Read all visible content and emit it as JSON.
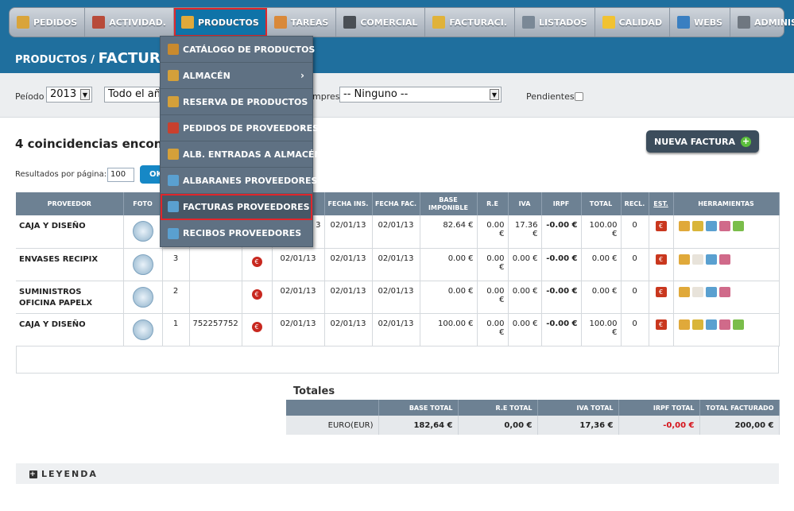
{
  "nav": {
    "items": [
      {
        "label": "PEDIDOS",
        "icon": "clipboard-icon",
        "color": "#d9a43a"
      },
      {
        "label": "ACTIVIDAD.",
        "icon": "puzzle-icon",
        "color": "#b84b3a"
      },
      {
        "label": "PRODUCTOS",
        "icon": "box-icon",
        "color": "#e0a93a"
      },
      {
        "label": "TAREAS",
        "icon": "folder-icon",
        "color": "#d9893a"
      },
      {
        "label": "COMERCIAL",
        "icon": "car-icon",
        "color": "#4a4f55"
      },
      {
        "label": "FACTURACI.",
        "icon": "bar-chart-icon",
        "color": "#e0b23a"
      },
      {
        "label": "LISTADOS",
        "icon": "printer-icon",
        "color": "#7a8896"
      },
      {
        "label": "CALIDAD",
        "icon": "star-icon",
        "color": "#f1c232"
      },
      {
        "label": "WEBS",
        "icon": "globe-icon",
        "color": "#3a7fc1"
      },
      {
        "label": "ADMINISTR.",
        "icon": "gear-icon",
        "color": "#6f7780"
      }
    ]
  },
  "header": {
    "section": "PRODUCTOS",
    "separator": "/",
    "title": "FACTURAS"
  },
  "filters": {
    "period_label": "Peíodo",
    "year_value": "2013",
    "range_value": "Todo el añ",
    "company_label": "mpresa",
    "company_value": "-- Ninguno --",
    "pending_label": "Pendientes"
  },
  "results": {
    "matches_text": "4 coincidencias encontra",
    "per_page_label": "Resultados por página:",
    "per_page_value": "100",
    "ok_label": "OK",
    "new_invoice_label": "NUEVA FACTURA",
    "plus_symbol": "+"
  },
  "menu": {
    "items": [
      {
        "label": "CATÁLOGO DE PRODUCTOS",
        "icon": "catalog-icon",
        "color": "#c98a2e",
        "submenu": ""
      },
      {
        "label": "ALMACÉN",
        "icon": "warehouse-icon",
        "color": "#d4a03a",
        "submenu": "›"
      },
      {
        "label": "RESERVA DE PRODUCTOS",
        "icon": "lock-box-icon",
        "color": "#d4a03a",
        "submenu": ""
      },
      {
        "label": "PEDIDOS DE PROVEEDORES",
        "icon": "order-box-icon",
        "color": "#c9402e",
        "submenu": "›"
      },
      {
        "label": "ALB. ENTRADAS A ALMACÉN",
        "icon": "delivery-icon",
        "color": "#d4a03a",
        "submenu": ""
      },
      {
        "label": "ALBARANES PROVEEDORES",
        "icon": "supplier-note-icon",
        "color": "#5aa0d0",
        "submenu": ""
      },
      {
        "label": "FACTURAS PROVEEDORES",
        "icon": "supplier-invoice-icon",
        "color": "#5aa0d0",
        "submenu": ""
      },
      {
        "label": "RECIBOS PROVEEDORES",
        "icon": "receipt-icon",
        "color": "#5aa0d0",
        "submenu": ""
      }
    ]
  },
  "table": {
    "headers": [
      "PROVEEDOR",
      "FOTO",
      "",
      "",
      "",
      "",
      "FECHA INS.",
      "FECHA FAC.",
      "BASE IMPONIBLE",
      "R.E",
      "IVA",
      "IRPF",
      "TOTAL",
      "RECL.",
      "EST.",
      "HERRAMIENTAS"
    ],
    "coin_symbol": "€",
    "est_symbol": "€",
    "rows": [
      {
        "proveedor": "CAJA Y DISEÑO",
        "num": "",
        "ref": "",
        "coin": false,
        "col6": "3",
        "fecha_ins": "02/01/13",
        "fecha_fac": "02/01/13",
        "base": "82.64 €",
        "re": "0.00 €",
        "iva": "17.36 €",
        "irpf": "-0.00 €",
        "total": "100.00 €",
        "recl": "0",
        "full_tools": true
      },
      {
        "proveedor": "ENVASES RECIPIX",
        "num": "3",
        "ref": "",
        "coin": true,
        "col6": "02/01/13",
        "fecha_ins": "02/01/13",
        "fecha_fac": "02/01/13",
        "base": "0.00 €",
        "re": "0.00 €",
        "iva": "0.00 €",
        "irpf": "-0.00 €",
        "total": "0.00 €",
        "recl": "0",
        "full_tools": false
      },
      {
        "proveedor": "SUMINISTROS OFICINA PAPELX",
        "num": "2",
        "ref": "",
        "coin": true,
        "col6": "02/01/13",
        "fecha_ins": "02/01/13",
        "fecha_fac": "02/01/13",
        "base": "0.00 €",
        "re": "0.00 €",
        "iva": "0.00 €",
        "irpf": "-0.00 €",
        "total": "0.00 €",
        "recl": "0",
        "full_tools": false
      },
      {
        "proveedor": "CAJA Y DISEÑO",
        "num": "1",
        "ref": "752257752",
        "coin": true,
        "col6": "02/01/13",
        "fecha_ins": "02/01/13",
        "fecha_fac": "02/01/13",
        "base": "100.00 €",
        "re": "0.00 €",
        "iva": "0.00 €",
        "irpf": "-0.00 €",
        "total": "100.00 €",
        "recl": "0",
        "full_tools": true
      }
    ]
  },
  "totals": {
    "title": "Totales",
    "headers": [
      "",
      "BASE TOTAL",
      "R.E TOTAL",
      "IVA TOTAL",
      "IRPF TOTAL",
      "TOTAL FACTURADO"
    ],
    "values": [
      "EURO(EUR)",
      "182,64 €",
      "0,00 €",
      "17,36 €",
      "-0,00 €",
      "200,00 €"
    ]
  },
  "legend": {
    "label": "LEYENDA",
    "toggle": "+"
  },
  "colors": {
    "accent": "#1f6f9e",
    "highlight": "#e0262b",
    "negative": "#d6121a"
  }
}
